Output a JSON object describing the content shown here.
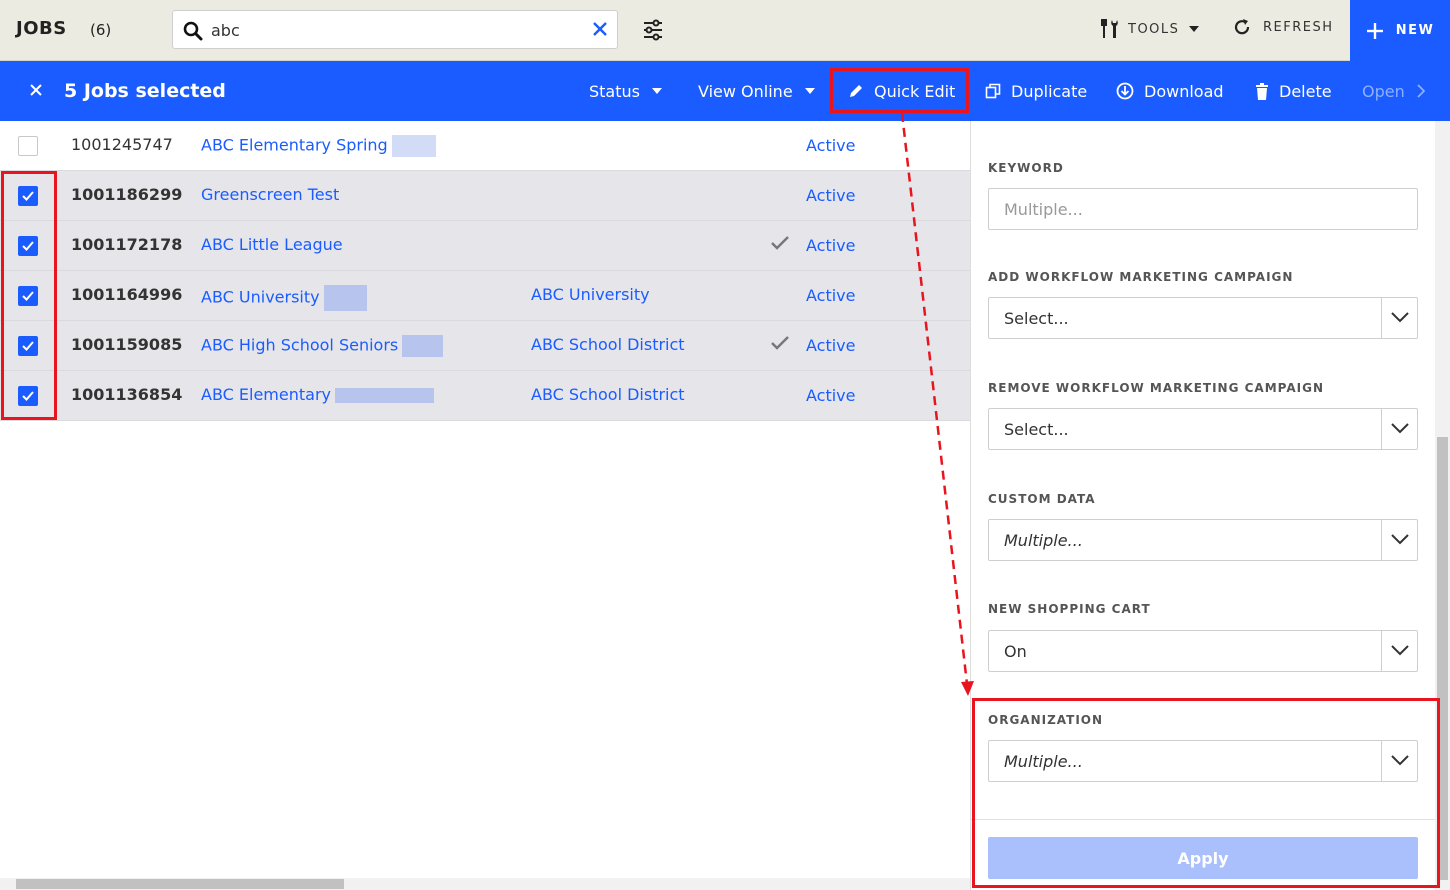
{
  "header": {
    "title": "JOBS",
    "count": "(6)",
    "search_value": "abc",
    "tools_label": "TOOLS",
    "refresh_label": "REFRESH",
    "new_label": "NEW"
  },
  "selection_bar": {
    "count_label": "5 Jobs selected",
    "actions": {
      "status": "Status",
      "view_online": "View Online",
      "quick_edit": "Quick Edit",
      "duplicate": "Duplicate",
      "download": "Download",
      "delete": "Delete",
      "open": "Open"
    }
  },
  "rows": [
    {
      "id": "1001245747",
      "name": "ABC Elementary Spring",
      "org": "",
      "checked": false,
      "status": "Active"
    },
    {
      "id": "1001186299",
      "name": "Greenscreen Test",
      "org": "",
      "checked": true,
      "status": "Active"
    },
    {
      "id": "1001172178",
      "name": "ABC Little League",
      "org": "",
      "checked": true,
      "status": "Active"
    },
    {
      "id": "1001164996",
      "name": "ABC University",
      "org": "ABC University",
      "checked": true,
      "status": "Active"
    },
    {
      "id": "1001159085",
      "name": "ABC High School Seniors",
      "org": "ABC School District",
      "checked": true,
      "status": "Active"
    },
    {
      "id": "1001136854",
      "name": "ABC Elementary",
      "org": "ABC School District",
      "checked": true,
      "status": "Active"
    }
  ],
  "panel": {
    "keyword": {
      "label": "KEYWORD",
      "placeholder": "Multiple..."
    },
    "add_campaign": {
      "label": "ADD WORKFLOW MARKETING CAMPAIGN",
      "value": "Select..."
    },
    "remove_campaign": {
      "label": "REMOVE WORKFLOW MARKETING CAMPAIGN",
      "value": "Select..."
    },
    "custom_data": {
      "label": "CUSTOM DATA",
      "value": "Multiple..."
    },
    "shopping_cart": {
      "label": "NEW SHOPPING CART",
      "value": "On"
    },
    "organization": {
      "label": "ORGANIZATION",
      "value": "Multiple..."
    },
    "apply_label": "Apply"
  },
  "colors": {
    "accent": "#1a5cff",
    "highlight": "#e8141e",
    "apply_disabled": "#a9c0fc"
  }
}
